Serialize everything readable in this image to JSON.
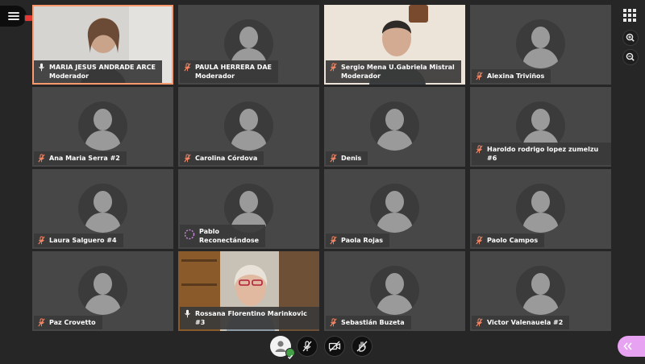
{
  "toolbar": {
    "menu_icon": "hamburger-icon",
    "recording_color": "#e53935",
    "layout_icon": "grid-icon",
    "zoom_in_icon": "zoom-in-icon",
    "zoom_out_icon": "zoom-out-icon"
  },
  "participants": [
    {
      "line1": "MARIA JESUS ANDRADE ARCE",
      "line2": "Moderador",
      "mic": "on",
      "video": true
    },
    {
      "line1": "PAULA HERRERA DAE",
      "line2": "Moderador",
      "mic": "muted",
      "video": false
    },
    {
      "line1": "Sergio Mena U.Gabriela Mistral",
      "line2": "Moderador",
      "mic": "muted",
      "video": true
    },
    {
      "line1": "Alexina Triviños",
      "line2": "",
      "mic": "muted",
      "video": false
    },
    {
      "line1": "Ana Maria Serra #2",
      "line2": "",
      "mic": "muted",
      "video": false
    },
    {
      "line1": "Carolina Córdova",
      "line2": "",
      "mic": "muted",
      "video": false
    },
    {
      "line1": "Denis",
      "line2": "",
      "mic": "muted",
      "video": false
    },
    {
      "line1": "Haroldo rodrigo lopez zumelzu #6",
      "line2": "",
      "mic": "muted",
      "video": false
    },
    {
      "line1": "Laura Salguero #4",
      "line2": "",
      "mic": "muted",
      "video": false
    },
    {
      "line1": "Pablo",
      "line2": "Reconectándose",
      "mic": "pending",
      "video": false
    },
    {
      "line1": "Paola Rojas",
      "line2": "",
      "mic": "muted",
      "video": false
    },
    {
      "line1": "Paolo Campos",
      "line2": "",
      "mic": "muted",
      "video": false
    },
    {
      "line1": "Paz Crovetto",
      "line2": "",
      "mic": "muted",
      "video": false
    },
    {
      "line1": "Rossana Florentino Marinkovic #3",
      "line2": "",
      "mic": "on",
      "video": true
    },
    {
      "line1": "Sebastián Buzeta",
      "line2": "",
      "mic": "muted",
      "video": false
    },
    {
      "line1": "Victor Valenauela #2",
      "line2": "",
      "mic": "muted",
      "video": false
    }
  ],
  "controls": {
    "status_icon": "user-status-icon",
    "status_color": "#43a047",
    "mic_icon": "mic-muted-icon",
    "camera_icon": "camera-off-icon",
    "share_icon": "hand-raise-icon",
    "panel_icon": "chevron-left-icon",
    "panel_color": "#e7a3f2"
  },
  "colors": {
    "background": "#262626",
    "tile": "#474747",
    "active_border": "#ff9a6e"
  }
}
